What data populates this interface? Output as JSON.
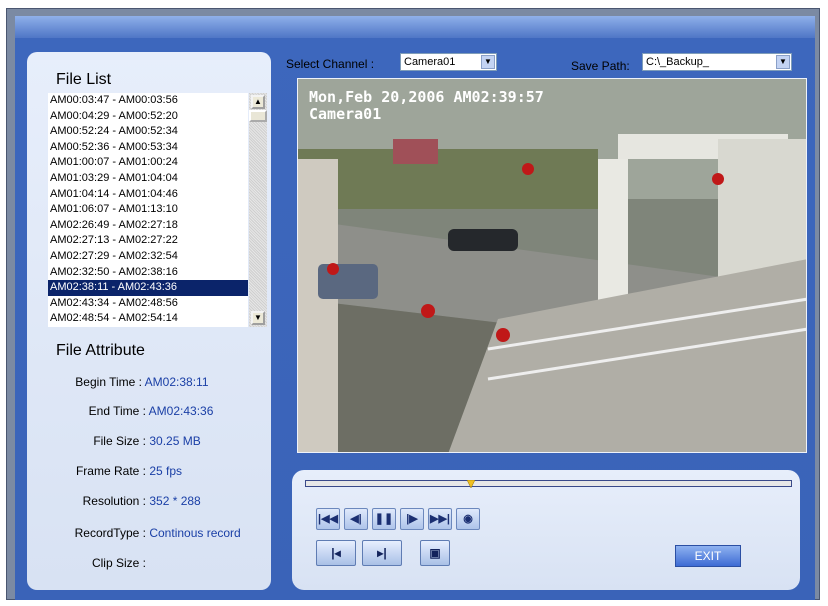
{
  "file_list": {
    "title": "File List",
    "items": [
      "AM00:03:47 - AM00:03:56",
      "AM00:04:29 - AM00:52:20",
      "AM00:52:24 - AM00:52:34",
      "AM00:52:36 - AM00:53:34",
      "AM01:00:07 - AM01:00:24",
      "AM01:03:29 - AM01:04:04",
      "AM01:04:14 - AM01:04:46",
      "AM01:06:07 - AM01:13:10",
      "AM02:26:49 - AM02:27:18",
      "AM02:27:13 - AM02:27:22",
      "AM02:27:29 - AM02:32:54",
      "AM02:32:50 - AM02:38:16",
      "AM02:38:11 - AM02:43:36",
      "AM02:43:34 - AM02:48:56",
      "AM02:48:54 - AM02:54:14"
    ],
    "selected_index": 12
  },
  "file_attribute": {
    "title": "File Attribute",
    "begin_time_label": "Begin Time :",
    "begin_time": "AM02:38:11",
    "end_time_label": "End Time :",
    "end_time": "AM02:43:36",
    "file_size_label": "File Size :",
    "file_size": "30.25 MB",
    "frame_rate_label": "Frame Rate :",
    "frame_rate": "25 fps",
    "resolution_label": "Resolution :",
    "resolution": "352 * 288",
    "record_type_label": "RecordType :",
    "record_type": "Continous record",
    "clip_size_label": "Clip Size :",
    "clip_size": ""
  },
  "top_controls": {
    "select_channel_label": "Select Channel :",
    "channel_value": "Camera01",
    "save_path_label": "Save Path:",
    "save_path_value": "C:\\_Backup_"
  },
  "video": {
    "overlay_datetime": "Mon,Feb 20,2006 AM02:39:57",
    "overlay_channel": "Camera01"
  },
  "playback": {
    "progress_fraction": 0.34,
    "exit_label": "EXIT"
  },
  "colors": {
    "accent": "#3a63b8",
    "selected": "#0b246a",
    "value_text": "#1a3fa6"
  }
}
